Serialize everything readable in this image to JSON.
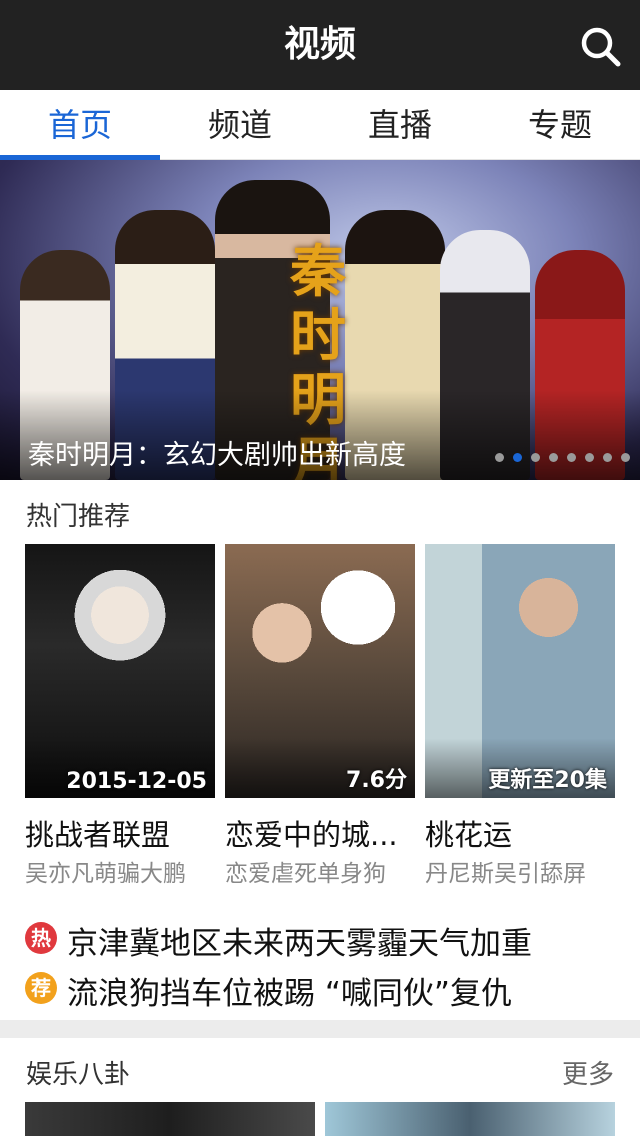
{
  "header": {
    "title": "视频",
    "search_icon": "search-icon"
  },
  "tabs": [
    {
      "label": "首页",
      "active": true
    },
    {
      "label": "频道",
      "active": false
    },
    {
      "label": "直播",
      "active": false
    },
    {
      "label": "专题",
      "active": false
    }
  ],
  "banner": {
    "caption": "秦时明月：玄幻大剧帅出新高度",
    "calligraphy": "秦时明月",
    "dots_total": 8,
    "active_dot": 1
  },
  "hot": {
    "title": "热门推荐",
    "cards": [
      {
        "badge": "2015-12-05",
        "name": "挑战者联盟",
        "sub": "吴亦凡萌骗大鹏"
      },
      {
        "badge": "7.6分",
        "name": "恋爱中的城...",
        "sub": "恋爱虐死单身狗"
      },
      {
        "badge": "更新至20集",
        "name": "桃花运",
        "sub": "丹尼斯吴引舔屏"
      }
    ]
  },
  "news": [
    {
      "tag": "热",
      "tag_color": "#e0393e",
      "text": "京津冀地区未来两天雾霾天气加重"
    },
    {
      "tag": "荐",
      "tag_color": "#f2a11c",
      "text": "流浪狗挡车位被踢 “喊同伙”复仇"
    }
  ],
  "entertainment": {
    "title": "娱乐八卦",
    "more": "更多"
  },
  "colors": {
    "accent": "#1a66d6",
    "topbar": "#222222"
  }
}
